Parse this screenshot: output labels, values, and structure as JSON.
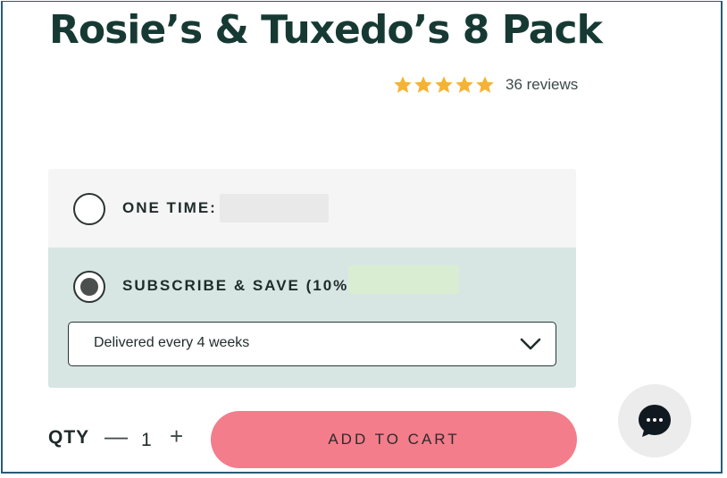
{
  "product": {
    "title": "Rosie’s & Tuxedo’s 8 Pack",
    "rating": 5,
    "reviews": "36 reviews",
    "colors": {
      "star": "#f5b335",
      "title": "#163a33"
    }
  },
  "purchase_options": {
    "one_time": {
      "label": "ONE TIME:",
      "selected": false,
      "price_placeholder_color": "#e9e9e9"
    },
    "subscribe": {
      "label": "SUBSCRIBE & SAVE (10%):",
      "selected": true,
      "price_placeholder_color": "#d8edd2"
    },
    "frequency": {
      "selected": "Delivered every 4 weeks"
    }
  },
  "quantity": {
    "label": "QTY",
    "value": "1",
    "minus": "—",
    "plus": "+"
  },
  "cart": {
    "label": "ADD TO CART",
    "color": "#f37d8b"
  },
  "chat": {
    "icon": "chat-bubble-icon"
  }
}
